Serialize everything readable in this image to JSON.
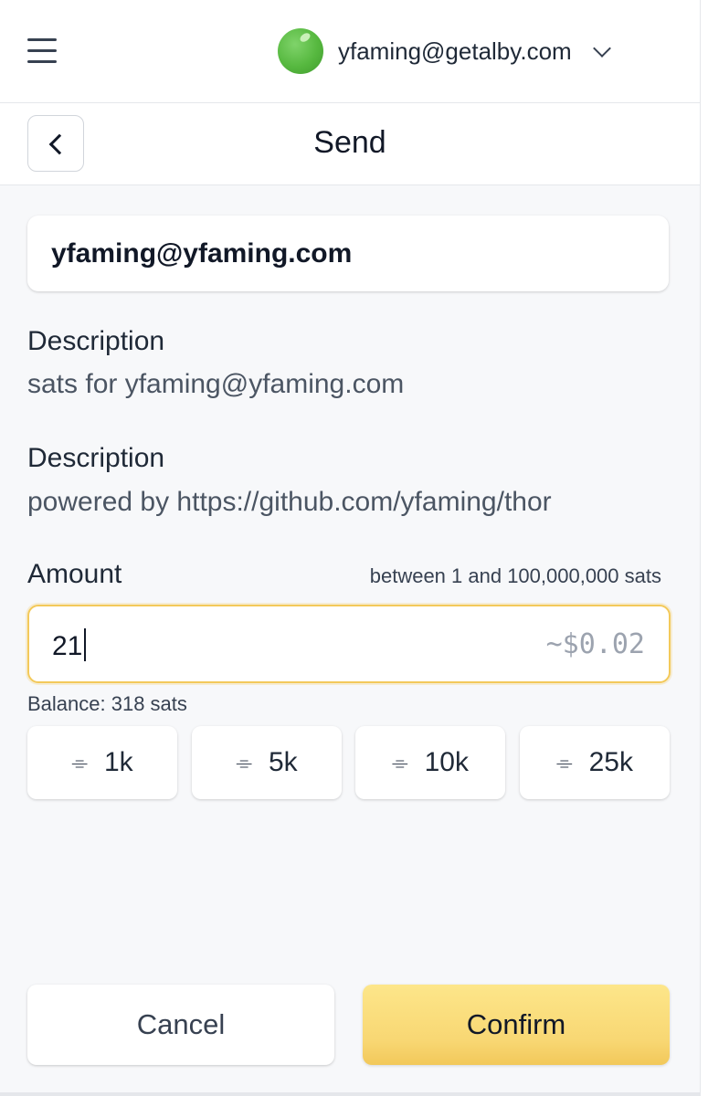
{
  "topbar": {
    "account_email": "yfaming@getalby.com",
    "menu_icon": "hamburger-menu-icon",
    "dropdown_icon": "chevron-down-icon"
  },
  "header": {
    "title": "Send",
    "back_icon": "chevron-left-icon"
  },
  "recipient": "yfaming@yfaming.com",
  "descriptions": [
    {
      "label": "Description",
      "value": "sats for yfaming@yfaming.com"
    },
    {
      "label": "Description",
      "value": "powered by https://github.com/yfaming/thor"
    }
  ],
  "amount": {
    "label": "Amount",
    "range_hint": "between 1 and 100,000,000 sats",
    "value": "21",
    "fiat": "~$0.02",
    "balance": "Balance: 318 sats"
  },
  "quick_amounts": [
    {
      "icon": "satoshi-icon",
      "label": "1k"
    },
    {
      "icon": "satoshi-icon",
      "label": "5k"
    },
    {
      "icon": "satoshi-icon",
      "label": "10k"
    },
    {
      "icon": "satoshi-icon",
      "label": "25k"
    }
  ],
  "actions": {
    "cancel": "Cancel",
    "confirm": "Confirm"
  },
  "colors": {
    "accent": "#f8d773",
    "input_focus_border": "#f3c95a",
    "avatar": "#56b83f"
  }
}
